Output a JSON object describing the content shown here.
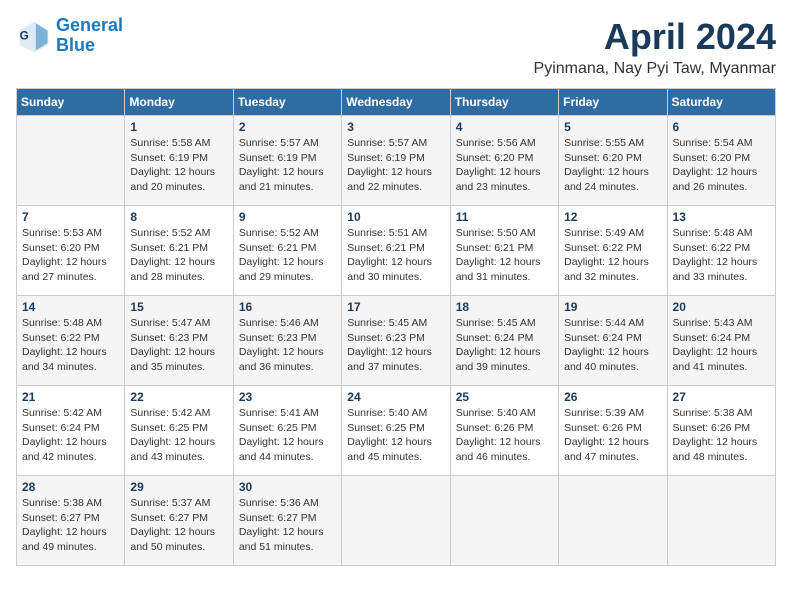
{
  "logo": {
    "line1": "General",
    "line2": "Blue"
  },
  "title": "April 2024",
  "subtitle": "Pyinmana, Nay Pyi Taw, Myanmar",
  "headers": [
    "Sunday",
    "Monday",
    "Tuesday",
    "Wednesday",
    "Thursday",
    "Friday",
    "Saturday"
  ],
  "weeks": [
    [
      {
        "day": "",
        "info": ""
      },
      {
        "day": "1",
        "info": "Sunrise: 5:58 AM\nSunset: 6:19 PM\nDaylight: 12 hours\nand 20 minutes."
      },
      {
        "day": "2",
        "info": "Sunrise: 5:57 AM\nSunset: 6:19 PM\nDaylight: 12 hours\nand 21 minutes."
      },
      {
        "day": "3",
        "info": "Sunrise: 5:57 AM\nSunset: 6:19 PM\nDaylight: 12 hours\nand 22 minutes."
      },
      {
        "day": "4",
        "info": "Sunrise: 5:56 AM\nSunset: 6:20 PM\nDaylight: 12 hours\nand 23 minutes."
      },
      {
        "day": "5",
        "info": "Sunrise: 5:55 AM\nSunset: 6:20 PM\nDaylight: 12 hours\nand 24 minutes."
      },
      {
        "day": "6",
        "info": "Sunrise: 5:54 AM\nSunset: 6:20 PM\nDaylight: 12 hours\nand 26 minutes."
      }
    ],
    [
      {
        "day": "7",
        "info": "Sunrise: 5:53 AM\nSunset: 6:20 PM\nDaylight: 12 hours\nand 27 minutes."
      },
      {
        "day": "8",
        "info": "Sunrise: 5:52 AM\nSunset: 6:21 PM\nDaylight: 12 hours\nand 28 minutes."
      },
      {
        "day": "9",
        "info": "Sunrise: 5:52 AM\nSunset: 6:21 PM\nDaylight: 12 hours\nand 29 minutes."
      },
      {
        "day": "10",
        "info": "Sunrise: 5:51 AM\nSunset: 6:21 PM\nDaylight: 12 hours\nand 30 minutes."
      },
      {
        "day": "11",
        "info": "Sunrise: 5:50 AM\nSunset: 6:21 PM\nDaylight: 12 hours\nand 31 minutes."
      },
      {
        "day": "12",
        "info": "Sunrise: 5:49 AM\nSunset: 6:22 PM\nDaylight: 12 hours\nand 32 minutes."
      },
      {
        "day": "13",
        "info": "Sunrise: 5:48 AM\nSunset: 6:22 PM\nDaylight: 12 hours\nand 33 minutes."
      }
    ],
    [
      {
        "day": "14",
        "info": "Sunrise: 5:48 AM\nSunset: 6:22 PM\nDaylight: 12 hours\nand 34 minutes."
      },
      {
        "day": "15",
        "info": "Sunrise: 5:47 AM\nSunset: 6:23 PM\nDaylight: 12 hours\nand 35 minutes."
      },
      {
        "day": "16",
        "info": "Sunrise: 5:46 AM\nSunset: 6:23 PM\nDaylight: 12 hours\nand 36 minutes."
      },
      {
        "day": "17",
        "info": "Sunrise: 5:45 AM\nSunset: 6:23 PM\nDaylight: 12 hours\nand 37 minutes."
      },
      {
        "day": "18",
        "info": "Sunrise: 5:45 AM\nSunset: 6:24 PM\nDaylight: 12 hours\nand 39 minutes."
      },
      {
        "day": "19",
        "info": "Sunrise: 5:44 AM\nSunset: 6:24 PM\nDaylight: 12 hours\nand 40 minutes."
      },
      {
        "day": "20",
        "info": "Sunrise: 5:43 AM\nSunset: 6:24 PM\nDaylight: 12 hours\nand 41 minutes."
      }
    ],
    [
      {
        "day": "21",
        "info": "Sunrise: 5:42 AM\nSunset: 6:24 PM\nDaylight: 12 hours\nand 42 minutes."
      },
      {
        "day": "22",
        "info": "Sunrise: 5:42 AM\nSunset: 6:25 PM\nDaylight: 12 hours\nand 43 minutes."
      },
      {
        "day": "23",
        "info": "Sunrise: 5:41 AM\nSunset: 6:25 PM\nDaylight: 12 hours\nand 44 minutes."
      },
      {
        "day": "24",
        "info": "Sunrise: 5:40 AM\nSunset: 6:25 PM\nDaylight: 12 hours\nand 45 minutes."
      },
      {
        "day": "25",
        "info": "Sunrise: 5:40 AM\nSunset: 6:26 PM\nDaylight: 12 hours\nand 46 minutes."
      },
      {
        "day": "26",
        "info": "Sunrise: 5:39 AM\nSunset: 6:26 PM\nDaylight: 12 hours\nand 47 minutes."
      },
      {
        "day": "27",
        "info": "Sunrise: 5:38 AM\nSunset: 6:26 PM\nDaylight: 12 hours\nand 48 minutes."
      }
    ],
    [
      {
        "day": "28",
        "info": "Sunrise: 5:38 AM\nSunset: 6:27 PM\nDaylight: 12 hours\nand 49 minutes."
      },
      {
        "day": "29",
        "info": "Sunrise: 5:37 AM\nSunset: 6:27 PM\nDaylight: 12 hours\nand 50 minutes."
      },
      {
        "day": "30",
        "info": "Sunrise: 5:36 AM\nSunset: 6:27 PM\nDaylight: 12 hours\nand 51 minutes."
      },
      {
        "day": "",
        "info": ""
      },
      {
        "day": "",
        "info": ""
      },
      {
        "day": "",
        "info": ""
      },
      {
        "day": "",
        "info": ""
      }
    ]
  ]
}
